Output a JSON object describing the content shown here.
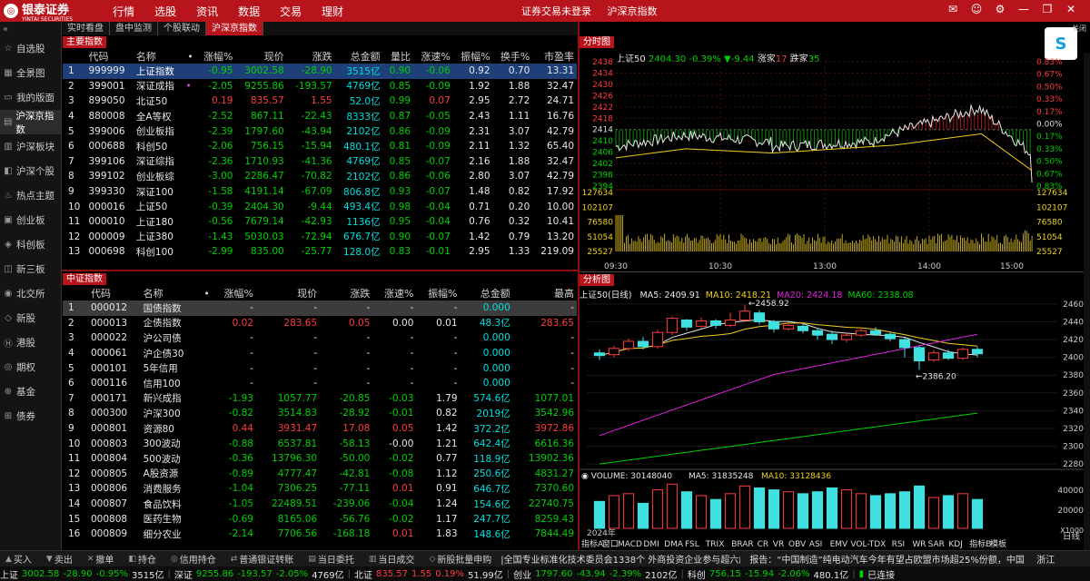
{
  "app": {
    "logo": "银泰证券",
    "logo_sub": "YINTAI SECURITIES",
    "nav": [
      "行情",
      "选股",
      "资讯",
      "数据",
      "交易",
      "理财"
    ],
    "status_login": "证券交易未登录",
    "status_view": "沪深京指数",
    "close_label": "关闭"
  },
  "sidebar": [
    "自选股",
    "全景图",
    "我的版面",
    "沪深京指数",
    "沪深板块",
    "沪深个股",
    "热点主题",
    "创业板",
    "科创板",
    "新三板",
    "北交所",
    "新股",
    "港股",
    "期权",
    "基金",
    "债券"
  ],
  "subtabs": [
    "实时看盘",
    "盘中监测",
    "个股联动",
    "沪深京指数"
  ],
  "main_index": {
    "title": "主要指数",
    "headers": [
      "代码",
      "名称",
      "•",
      "涨幅%",
      "现价",
      "涨跌",
      "总金额",
      "量比",
      "涨速%",
      "振幅%",
      "换手%",
      "市盈率"
    ],
    "rows": [
      [
        "1",
        "999999",
        "上证指数",
        "",
        "-0.95",
        "3002.58",
        "-28.90",
        "3515亿",
        "0.90",
        "-0.06",
        "0.92",
        "0.70",
        "13.31"
      ],
      [
        "2",
        "399001",
        "深证成指",
        "•",
        "-2.05",
        "9255.86",
        "-193.57",
        "4769亿",
        "0.85",
        "-0.09",
        "1.92",
        "1.88",
        "32.47"
      ],
      [
        "3",
        "899050",
        "北证50",
        "",
        "0.19",
        "835.57",
        "1.55",
        "52.0亿",
        "0.99",
        "0.07",
        "2.95",
        "2.72",
        "24.71"
      ],
      [
        "4",
        "880008",
        "全A等权",
        "",
        "-2.52",
        "867.11",
        "-22.43",
        "8333亿",
        "0.87",
        "-0.05",
        "2.43",
        "1.11",
        "16.76"
      ],
      [
        "5",
        "399006",
        "创业板指",
        "",
        "-2.39",
        "1797.60",
        "-43.94",
        "2102亿",
        "0.86",
        "-0.09",
        "2.31",
        "3.07",
        "42.79"
      ],
      [
        "6",
        "000688",
        "科创50",
        "",
        "-2.06",
        "756.15",
        "-15.94",
        "480.1亿",
        "0.81",
        "-0.09",
        "2.11",
        "1.32",
        "65.40"
      ],
      [
        "7",
        "399106",
        "深证综指",
        "",
        "-2.36",
        "1710.93",
        "-41.36",
        "4769亿",
        "0.85",
        "-0.07",
        "2.16",
        "1.88",
        "32.47"
      ],
      [
        "8",
        "399102",
        "创业板综",
        "",
        "-3.00",
        "2286.47",
        "-70.82",
        "2102亿",
        "0.86",
        "-0.06",
        "2.80",
        "3.07",
        "42.79"
      ],
      [
        "9",
        "399330",
        "深证100",
        "",
        "-1.58",
        "4191.14",
        "-67.09",
        "806.8亿",
        "0.93",
        "-0.07",
        "1.48",
        "0.82",
        "17.92"
      ],
      [
        "10",
        "000016",
        "上证50",
        "",
        "-0.39",
        "2404.30",
        "-9.44",
        "493.4亿",
        "0.98",
        "-0.04",
        "0.71",
        "0.20",
        "10.00"
      ],
      [
        "11",
        "000010",
        "上证180",
        "",
        "-0.56",
        "7679.14",
        "-42.93",
        "1136亿",
        "0.95",
        "-0.04",
        "0.76",
        "0.32",
        "10.41"
      ],
      [
        "12",
        "000009",
        "上证380",
        "",
        "-1.43",
        "5030.03",
        "-72.94",
        "676.7亿",
        "0.90",
        "-0.07",
        "1.42",
        "0.79",
        "13.20"
      ],
      [
        "13",
        "000698",
        "科创100",
        "",
        "-2.99",
        "835.00",
        "-25.77",
        "128.0亿",
        "0.83",
        "-0.01",
        "2.95",
        "1.33",
        "219.09"
      ]
    ]
  },
  "csi_index": {
    "title": "中证指数",
    "headers": [
      "代码",
      "名称",
      "•",
      "涨幅%",
      "现价",
      "涨跌",
      "涨速%",
      "振幅%",
      "总金额",
      "最高"
    ],
    "rows": [
      [
        "1",
        "000012",
        "国债指数",
        "",
        "-",
        "-",
        "-",
        "-",
        "-",
        "0.000",
        "-"
      ],
      [
        "2",
        "000013",
        "企债指数",
        "",
        "0.02",
        "283.65",
        "0.05",
        "0.00",
        "0.01",
        "48.3亿",
        "283.65"
      ],
      [
        "3",
        "000022",
        "沪公司债",
        "",
        "-",
        "-",
        "-",
        "-",
        "-",
        "0.000",
        "-"
      ],
      [
        "4",
        "000061",
        "沪企债30",
        "",
        "-",
        "-",
        "-",
        "-",
        "-",
        "0.000",
        "-"
      ],
      [
        "5",
        "000101",
        "5年信用",
        "",
        "-",
        "-",
        "-",
        "-",
        "-",
        "0.000",
        "-"
      ],
      [
        "6",
        "000116",
        "信用100",
        "",
        "-",
        "-",
        "-",
        "-",
        "-",
        "0.000",
        "-"
      ],
      [
        "7",
        "000171",
        "新兴成指",
        "",
        "-1.93",
        "1057.77",
        "-20.85",
        "-0.03",
        "1.79",
        "574.6亿",
        "1077.01"
      ],
      [
        "8",
        "000300",
        "沪深300",
        "",
        "-0.82",
        "3514.83",
        "-28.92",
        "-0.01",
        "0.82",
        "2019亿",
        "3542.96"
      ],
      [
        "9",
        "000801",
        "资源80",
        "",
        "0.44",
        "3931.47",
        "17.08",
        "0.05",
        "1.42",
        "372.2亿",
        "3972.86"
      ],
      [
        "10",
        "000803",
        "300波动",
        "",
        "-0.88",
        "6537.81",
        "-58.13",
        "-0.00",
        "1.21",
        "642.4亿",
        "6616.36"
      ],
      [
        "11",
        "000804",
        "500波动",
        "",
        "-0.36",
        "13796.30",
        "-50.00",
        "-0.02",
        "0.77",
        "118.9亿",
        "13902.36"
      ],
      [
        "12",
        "000805",
        "A股资源",
        "",
        "-0.89",
        "4777.47",
        "-42.81",
        "-0.08",
        "1.12",
        "250.6亿",
        "4831.27"
      ],
      [
        "13",
        "000806",
        "消费服务",
        "",
        "-1.04",
        "7306.25",
        "-77.11",
        "0.01",
        "0.91",
        "646.7亿",
        "7370.60"
      ],
      [
        "14",
        "000807",
        "食品饮料",
        "",
        "-1.05",
        "22489.51",
        "-239.06",
        "-0.04",
        "1.24",
        "154.6亿",
        "22740.75"
      ],
      [
        "15",
        "000808",
        "医药生物",
        "",
        "-0.69",
        "8165.06",
        "-56.76",
        "-0.02",
        "1.17",
        "247.7亿",
        "8259.43"
      ],
      [
        "16",
        "000809",
        "细分农业",
        "",
        "-2.14",
        "7706.56",
        "-168.18",
        "0.01",
        "1.83",
        "148.6亿",
        "7844.49"
      ]
    ]
  },
  "intraday": {
    "title": "分时图",
    "legend": [
      "上证50",
      "2404.30",
      "-0.39%",
      "▼-9.44",
      "涨家",
      "17",
      "跌家",
      "35"
    ],
    "price_labels": [
      "2438",
      "2434",
      "2430",
      "2426",
      "2422",
      "2418",
      "2414",
      "2410",
      "2406",
      "2402",
      "2398",
      "2394"
    ],
    "pct_labels": [
      "0.83%",
      "0.67%",
      "0.50%",
      "0.33%",
      "0.17%",
      "0.00%",
      "0.17%",
      "0.33%",
      "0.50%",
      "0.67%",
      "0.83%"
    ],
    "vol_labels": [
      "127634",
      "102107",
      "76580",
      "51054",
      "25527"
    ],
    "times": [
      "09:30",
      "10:30",
      "13:00",
      "14:00",
      "15:00"
    ],
    "last_price": 2404.3
  },
  "chart_data": {
    "type": "candlestick",
    "title": "分析图",
    "series_name": "上证50(日线)",
    "ma_legend": [
      {
        "name": "MA5",
        "value": "2409.91",
        "color": "#e6e6e6"
      },
      {
        "name": "MA10",
        "value": "2418.21",
        "color": "#f0d020"
      },
      {
        "name": "MA20",
        "value": "2424.18",
        "color": "#e020e0"
      },
      {
        "name": "MA60",
        "value": "2338.08",
        "color": "#00d000"
      }
    ],
    "ylabels": [
      "2460",
      "2440",
      "2420",
      "2400",
      "2380",
      "2360",
      "2340",
      "2320",
      "2300",
      "2280"
    ],
    "annotations": [
      "2458.92",
      "2386.20"
    ],
    "volume_legend": [
      "VOLUME: 30148040",
      "MA5: 31835248",
      "MA10: 33128436"
    ],
    "vol_ylabels": [
      "40000",
      "20000",
      "X1000"
    ],
    "year": "2024年",
    "candles": [
      [
        2405,
        2402,
        2409,
        2397
      ],
      [
        2403,
        2410,
        2413,
        2400
      ],
      [
        2410,
        2418,
        2421,
        2407
      ],
      [
        2418,
        2412,
        2423,
        2409
      ],
      [
        2412,
        2428,
        2431,
        2410
      ],
      [
        2428,
        2444,
        2446,
        2425
      ],
      [
        2442,
        2434,
        2443,
        2430
      ],
      [
        2435,
        2441,
        2445,
        2433
      ],
      [
        2441,
        2436,
        2443,
        2432
      ],
      [
        2436,
        2442,
        2450,
        2434
      ],
      [
        2442,
        2452,
        2459,
        2440
      ],
      [
        2450,
        2440,
        2453,
        2437
      ],
      [
        2440,
        2432,
        2442,
        2428
      ],
      [
        2432,
        2436,
        2440,
        2430
      ],
      [
        2435,
        2430,
        2438,
        2427
      ],
      [
        2430,
        2425,
        2433,
        2420
      ],
      [
        2426,
        2420,
        2430,
        2415
      ],
      [
        2420,
        2425,
        2428,
        2417
      ],
      [
        2425,
        2430,
        2434,
        2423
      ],
      [
        2430,
        2426,
        2434,
        2424
      ],
      [
        2426,
        2421,
        2428,
        2418
      ],
      [
        2420,
        2411,
        2422,
        2400
      ],
      [
        2411,
        2396,
        2413,
        2386
      ],
      [
        2397,
        2405,
        2408,
        2395
      ],
      [
        2405,
        2399,
        2409,
        2397
      ],
      [
        2399,
        2409,
        2411,
        2397
      ],
      [
        2409,
        2404,
        2412,
        2400
      ]
    ],
    "volumes": [
      28,
      34,
      36,
      26,
      40,
      46,
      38,
      34,
      30,
      36,
      44,
      42,
      40,
      38,
      36,
      38,
      42,
      40,
      36,
      34,
      36,
      38,
      44,
      32,
      34,
      36,
      30
    ]
  },
  "bottom": {
    "buttons": [
      "买入",
      "卖出",
      "撤单",
      "持仓",
      "信用持仓",
      "普通银证转账",
      "当日委托",
      "当日成交",
      "新股批量申购"
    ],
    "news": "|全国专业标准化技术委员会1338个 外商投资企业参与超六成",
    "report": "报告：“中国制造”纯电动汽车今年有望占欧盟市场超25%份额，中国",
    "tab_label": "浙江",
    "ticker": [
      [
        "上证",
        "3002.58",
        "-28.90",
        "-0.95%",
        "3515亿"
      ],
      [
        "深证",
        "9255.86",
        "-193.57",
        "-2.05%",
        "4769亿"
      ],
      [
        "北证",
        "835.57",
        "1.55",
        "0.19%",
        "51.99亿"
      ],
      [
        "创业",
        "1797.60",
        "-43.94",
        "-2.39%",
        "2102亿"
      ],
      [
        "科创",
        "756.15",
        "-15.94",
        "-2.06%",
        "480.1亿"
      ]
    ],
    "conn": "已连接"
  },
  "bottom_tabs": [
    "指标A",
    "窗口",
    "MACD",
    "DMI",
    "DMA",
    "FSL",
    "TRIX",
    "BRAR",
    "CR",
    "VR",
    "OBV",
    "ASI",
    "EMV",
    "VOL-TDX",
    "RSI",
    "WR",
    "SAR",
    "KDJ",
    "指标B",
    "模板"
  ],
  "side_right": "日线"
}
